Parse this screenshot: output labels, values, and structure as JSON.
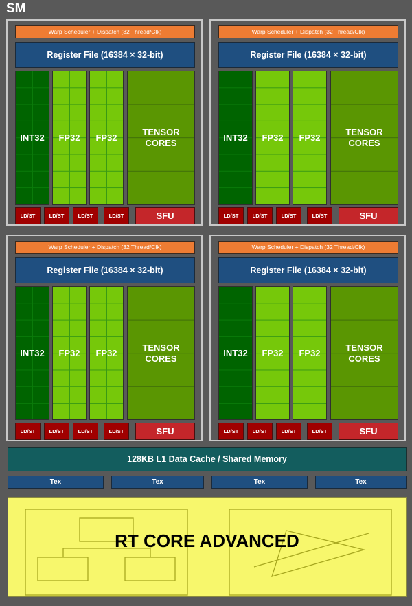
{
  "title": "SM",
  "processing_blocks": [
    {
      "warp": "Warp Scheduler + Dispatch (32 Thread/Clk)",
      "register": "Register File (16384 × 32-bit)",
      "int32": "INT32",
      "fp32": "FP32",
      "tensor_line1": "TENSOR",
      "tensor_line2": "CORES",
      "ldst": "LD/ST",
      "sfu": "SFU"
    },
    {
      "warp": "Warp Scheduler + Dispatch (32 Thread/Clk)",
      "register": "Register File (16384 × 32-bit)",
      "int32": "INT32",
      "fp32": "FP32",
      "tensor_line1": "TENSOR",
      "tensor_line2": "CORES",
      "ldst": "LD/ST",
      "sfu": "SFU"
    },
    {
      "warp": "Warp Scheduler + Dispatch (32 Thread/Clk)",
      "register": "Register File (16384 × 32-bit)",
      "int32": "INT32",
      "fp32": "FP32",
      "tensor_line1": "TENSOR",
      "tensor_line2": "CORES",
      "ldst": "LD/ST",
      "sfu": "SFU"
    },
    {
      "warp": "Warp Scheduler + Dispatch (32 Thread/Clk)",
      "register": "Register File (16384 × 32-bit)",
      "int32": "INT32",
      "fp32": "FP32",
      "tensor_line1": "TENSOR",
      "tensor_line2": "CORES",
      "ldst": "LD/ST",
      "sfu": "SFU"
    }
  ],
  "l1_cache": "128KB L1 Data Cache / Shared Memory",
  "tex_units": [
    "Tex",
    "Tex",
    "Tex",
    "Tex"
  ],
  "rt_core": "RT CORE ADVANCED",
  "colors": {
    "background": "#595959",
    "warp_scheduler": "#ee7c33",
    "register_file": "#1f4f80",
    "int32": "#006400",
    "fp32": "#76c80a",
    "tensor": "#5a9602",
    "ldst": "#a00000",
    "sfu": "#c4262a",
    "l1_cache": "#135d5e",
    "rt_core": "#f7f76c"
  }
}
